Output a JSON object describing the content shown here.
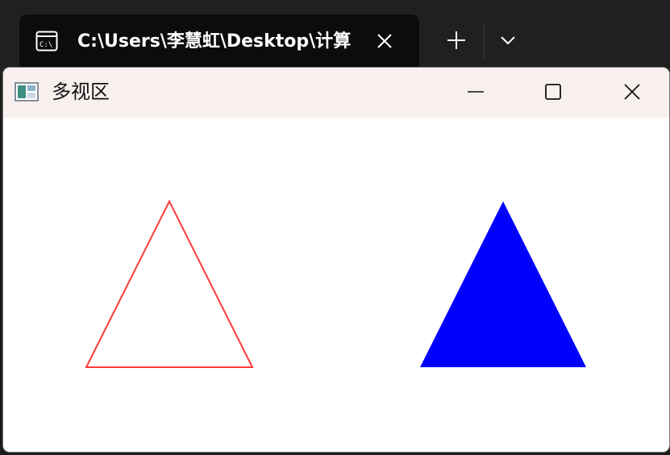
{
  "terminal": {
    "tab_title": "C:\\Users\\李慧虹\\Desktop\\计算",
    "tab_icon": "console-icon",
    "close_icon": "close-icon",
    "new_tab_icon": "plus-icon",
    "dropdown_icon": "chevron-down-icon"
  },
  "window": {
    "title": "多视区",
    "app_icon": "window-app-icon",
    "controls": {
      "minimize": "minimize-icon",
      "maximize": "maximize-icon",
      "close": "close-icon"
    }
  },
  "viewports": [
    {
      "shape": "triangle",
      "style": "outline",
      "color": "#ff3b3b"
    },
    {
      "shape": "triangle",
      "style": "filled",
      "color": "#0000ff"
    }
  ],
  "colors": {
    "terminal_bg": "#202020",
    "tab_bg": "#0c0c0c",
    "titlebar_bg": "#f8f0ee",
    "canvas_bg": "#ffffff"
  }
}
